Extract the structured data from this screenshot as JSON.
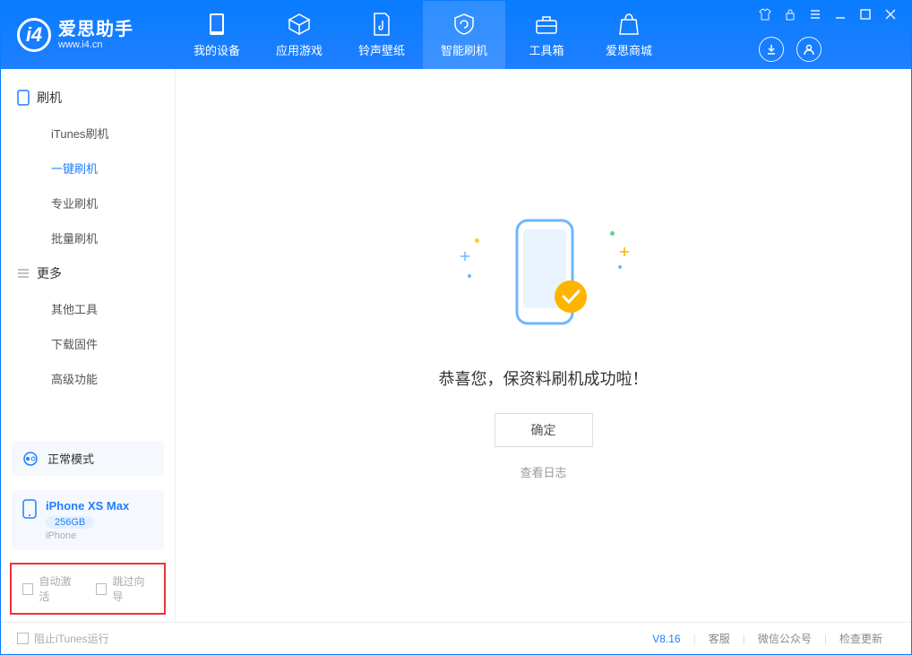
{
  "app": {
    "title": "爱思助手",
    "subtitle": "www.i4.cn"
  },
  "nav": {
    "items": [
      {
        "label": "我的设备"
      },
      {
        "label": "应用游戏"
      },
      {
        "label": "铃声壁纸"
      },
      {
        "label": "智能刷机"
      },
      {
        "label": "工具箱"
      },
      {
        "label": "爱思商城"
      }
    ]
  },
  "sidebar": {
    "group1": {
      "title": "刷机",
      "items": [
        "iTunes刷机",
        "一键刷机",
        "专业刷机",
        "批量刷机"
      ],
      "activeIndex": 1
    },
    "group2": {
      "title": "更多",
      "items": [
        "其他工具",
        "下载固件",
        "高级功能"
      ]
    },
    "mode_card": {
      "label": "正常模式"
    },
    "device_card": {
      "name": "iPhone XS Max",
      "capacity": "256GB",
      "type": "iPhone"
    },
    "checkboxes": {
      "auto_activate": "自动激活",
      "skip_guide": "跳过向导"
    }
  },
  "main": {
    "message": "恭喜您，保资料刷机成功啦！",
    "ok_button": "确定",
    "view_log": "查看日志"
  },
  "footer": {
    "block_itunes": "阻止iTunes运行",
    "version": "V8.16",
    "links": [
      "客服",
      "微信公众号",
      "检查更新"
    ]
  }
}
